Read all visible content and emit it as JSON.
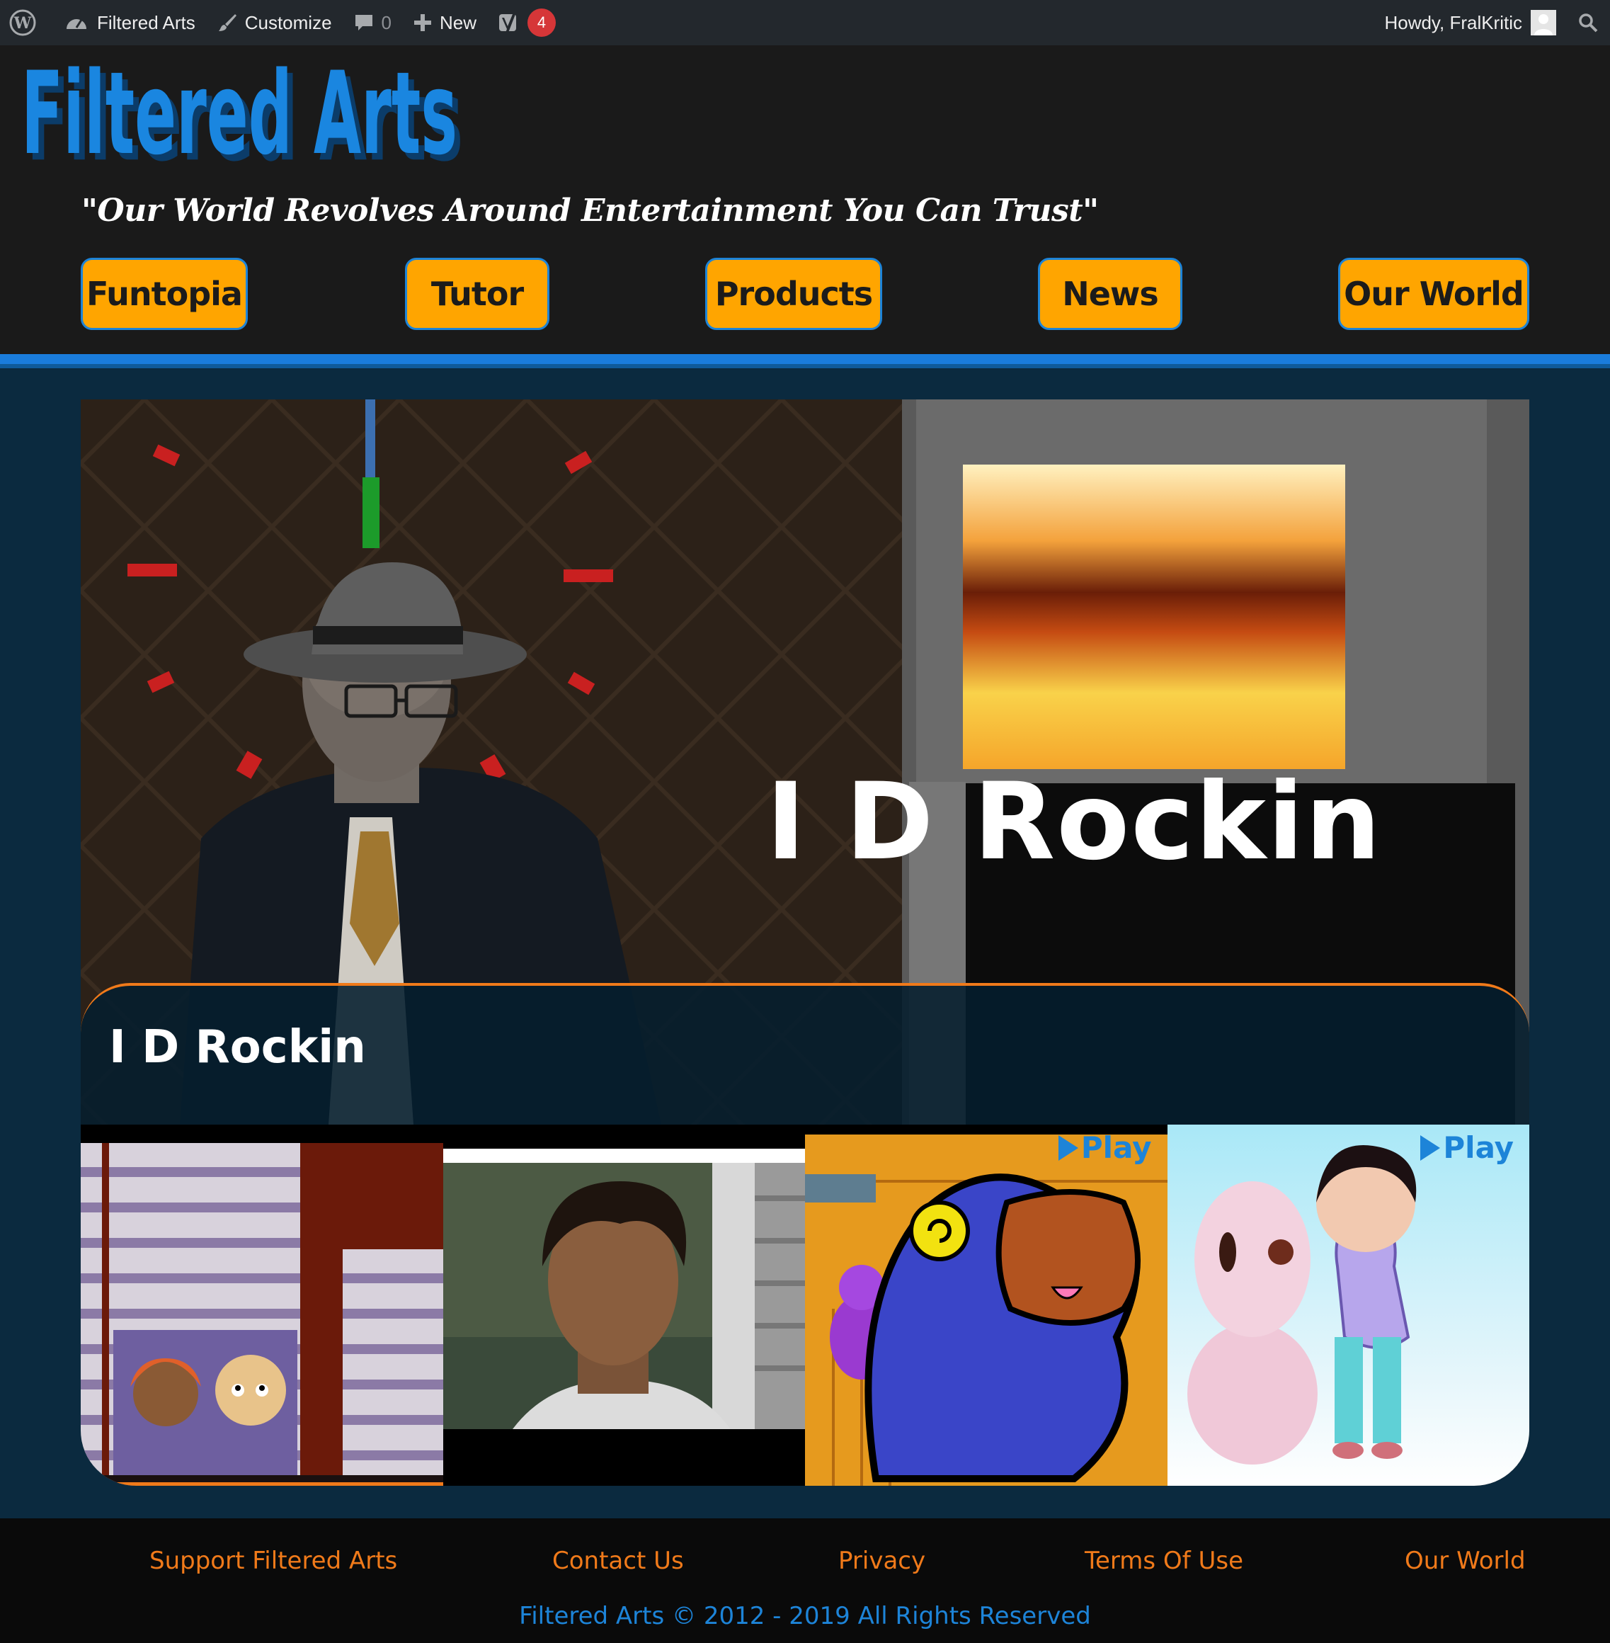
{
  "adminbar": {
    "site_name": "Filtered Arts",
    "customize": "Customize",
    "comments_count": "0",
    "new_label": "New",
    "yoast_badge": "4",
    "howdy": "Howdy, FralKritic"
  },
  "header": {
    "logo_text": "Filtered Arts",
    "tagline": "\"Our World Revolves Around Entertainment You Can Trust\"",
    "nav": [
      "Funtopia",
      "Tutor",
      "Products",
      "News",
      "Our World"
    ]
  },
  "hero": {
    "overlay_text": "I D Rockin",
    "title": "I D Rockin",
    "thumbs": [
      {
        "play_label": ""
      },
      {
        "play_label": ""
      },
      {
        "play_label": "Play"
      },
      {
        "play_label": "Play"
      }
    ]
  },
  "footer": {
    "links": [
      "Support Filtered Arts",
      "Contact Us",
      "Privacy",
      "Terms Of Use",
      "Our World"
    ],
    "copyright": "Filtered Arts © 2012 - 2019 All Rights Reserved"
  },
  "colors": {
    "adminbar": "#23282d",
    "header": "#1a1a1a",
    "accent_blue": "#1a7cdc",
    "nav_orange": "#ffa500",
    "hero_border": "#f07a1a",
    "footer_link": "#f07a1a",
    "page_bg": "#0b2a3f"
  }
}
